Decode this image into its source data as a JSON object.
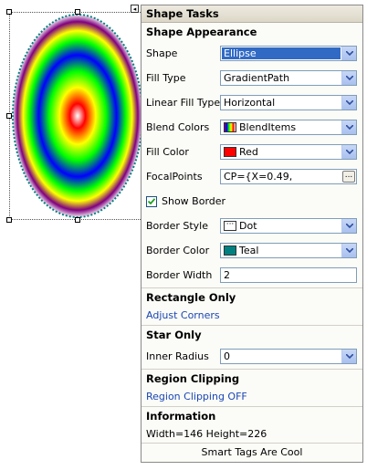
{
  "panel": {
    "title": "Shape Tasks",
    "appearance": {
      "heading": "Shape Appearance",
      "shape": {
        "label": "Shape",
        "value": "Ellipse"
      },
      "fill_type": {
        "label": "Fill Type",
        "value": "GradientPath"
      },
      "linear_fill_type": {
        "label": "Linear Fill Type",
        "value": "Horizontal"
      },
      "blend_colors": {
        "label": "Blend Colors",
        "value": "BlendItems"
      },
      "fill_color": {
        "label": "Fill Color",
        "value": "Red",
        "color": "#ff0000"
      },
      "focal_points": {
        "label": "FocalPoints",
        "value": "CP={X=0.49,",
        "browse": "..."
      },
      "show_border": {
        "label": "Show Border",
        "checked": true
      },
      "border_style": {
        "label": "Border Style",
        "value": "Dot"
      },
      "border_color": {
        "label": "Border Color",
        "value": "Teal",
        "color": "#008080"
      },
      "border_width": {
        "label": "Border Width",
        "value": "2"
      }
    },
    "rectangle": {
      "heading": "Rectangle Only",
      "adjust_corners": "Adjust Corners"
    },
    "star": {
      "heading": "Star Only",
      "inner_radius": {
        "label": "Inner Radius",
        "value": "0"
      }
    },
    "region": {
      "heading": "Region Clipping",
      "link": "Region Clipping OFF"
    },
    "information": {
      "heading": "Information",
      "text": "Width=146 Height=226"
    },
    "footer": "Smart Tags Are Cool"
  },
  "smart_tag_glyph": "◂"
}
